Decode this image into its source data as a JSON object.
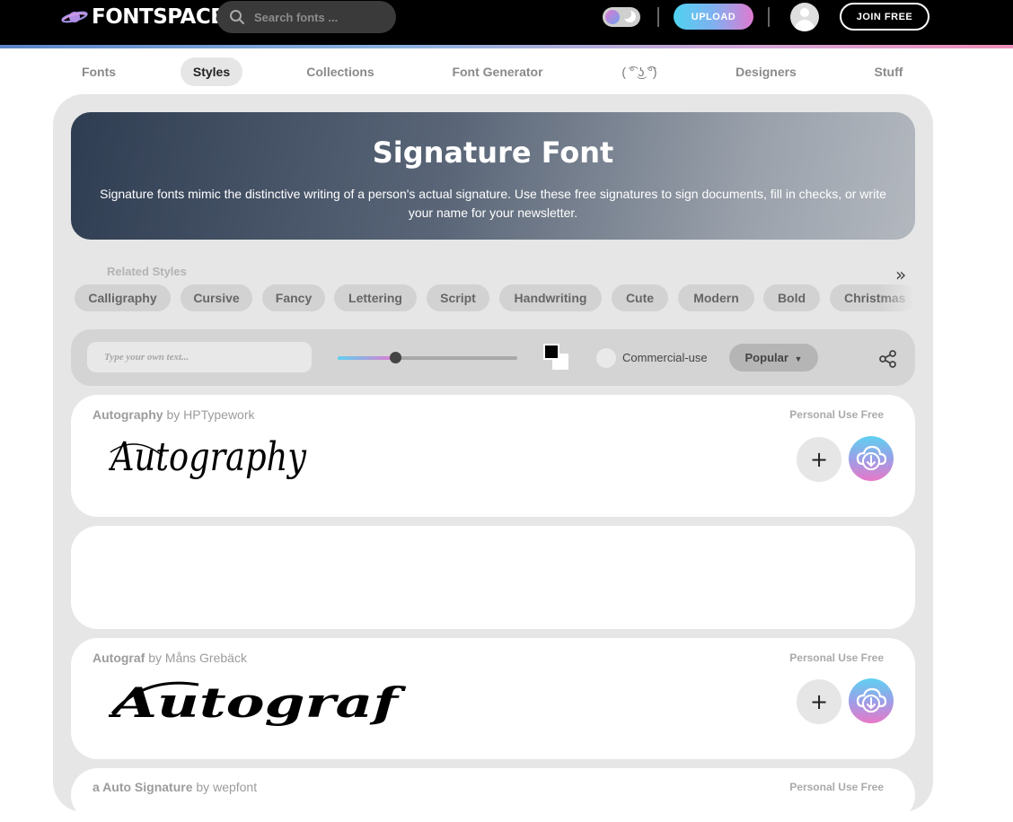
{
  "header": {
    "logo_text": "FONTSPACE",
    "search_placeholder": "Search fonts ...",
    "upload_label": "UPLOAD",
    "join_label": "JOIN FREE"
  },
  "nav": {
    "items": [
      {
        "label": "Fonts"
      },
      {
        "label": "Styles",
        "active": true
      },
      {
        "label": "Collections"
      },
      {
        "label": "Font Generator"
      },
      {
        "label": "( ͡° ͜ʖ ͡°)"
      },
      {
        "label": "Designers"
      },
      {
        "label": "Stuff"
      }
    ]
  },
  "hero": {
    "title": "Signature Font",
    "description": "Signature fonts mimic the distinctive writing of a person's actual signature. Use these free signatures to sign documents, fill in checks, or write your name for your newsletter."
  },
  "related": {
    "title": "Related Styles",
    "chips": [
      "Calligraphy",
      "Cursive",
      "Fancy",
      "Lettering",
      "Script",
      "Handwriting",
      "Cute",
      "Modern",
      "Bold",
      "Christmas"
    ]
  },
  "filters": {
    "text_placeholder": "Type your own text...",
    "size_fraction": 0.32,
    "commercial_label": "Commercial-use",
    "sort_label": "Popular"
  },
  "fonts": [
    {
      "name": "Autography",
      "by": "by",
      "author": "HPTypework",
      "license": "Personal Use Free",
      "preview": "Autography"
    },
    {
      "name": "Autograf",
      "by": "by",
      "author": "Måns Grebäck",
      "license": "Personal Use Free",
      "preview": "Autograf"
    },
    {
      "name": "a Auto Signature",
      "by": "by",
      "author": "wepfont",
      "license": "Personal Use Free"
    }
  ],
  "colors": {
    "accent_cyan": "#4fd3f0",
    "accent_pink": "#e07ad0",
    "topbar": "#000000"
  }
}
